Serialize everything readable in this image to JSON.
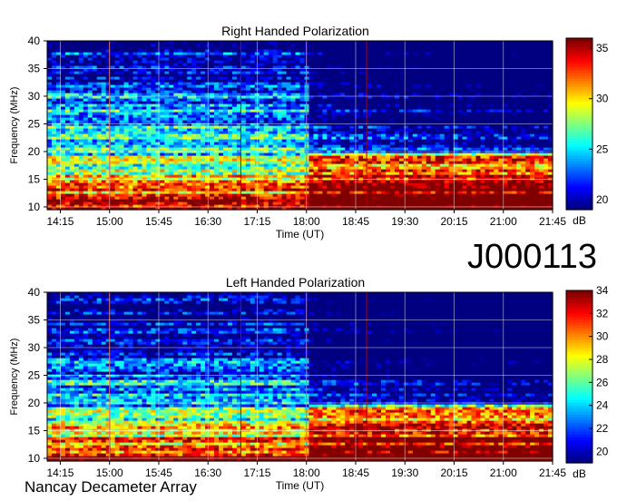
{
  "observation_id": "J000113",
  "footer": "Nancay Decameter Array",
  "chart_data": [
    {
      "type": "heatmap",
      "title": "Right Handed Polarization",
      "xlabel": "Time (UT)",
      "ylabel": "Frequency (MHz)",
      "xticks": [
        "14:15",
        "15:00",
        "15:45",
        "16:30",
        "17:15",
        "18:00",
        "18:45",
        "19:30",
        "20:15",
        "21:00",
        "21:45"
      ],
      "xrange": [
        "14:03",
        "21:45"
      ],
      "yticks": [
        10,
        15,
        20,
        25,
        30,
        35,
        40
      ],
      "ylim": [
        9.5,
        40
      ],
      "colorbar": {
        "label": "dB",
        "ticks": [
          20,
          25,
          30,
          35
        ],
        "range": [
          19,
          36
        ]
      },
      "colormap": "jet",
      "grid": true
    },
    {
      "type": "heatmap",
      "title": "Left Handed Polarization",
      "xlabel": "Time (UT)",
      "ylabel": "Frequency (MHz)",
      "xticks": [
        "14:15",
        "15:00",
        "15:45",
        "16:30",
        "17:15",
        "18:00",
        "18:45",
        "19:30",
        "20:15",
        "21:00",
        "21:45"
      ],
      "xrange": [
        "14:03",
        "21:45"
      ],
      "yticks": [
        10,
        15,
        20,
        25,
        30,
        35,
        40
      ],
      "ylim": [
        9.5,
        40
      ],
      "colorbar": {
        "label": "dB",
        "ticks": [
          20,
          22,
          24,
          26,
          28,
          30,
          32,
          34
        ],
        "range": [
          19,
          34
        ]
      },
      "colormap": "jet",
      "grid": true
    }
  ]
}
